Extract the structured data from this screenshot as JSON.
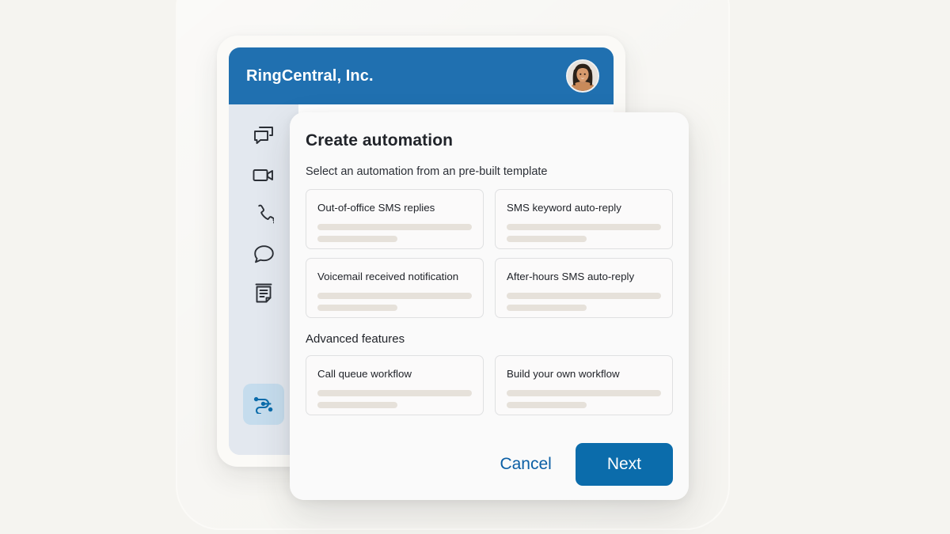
{
  "app": {
    "title": "RingCentral, Inc.",
    "header_color": "#2070b0",
    "avatar_name": "user-avatar",
    "sidebar": {
      "items": [
        {
          "icon": "messages-icon",
          "label": "Message",
          "active": false
        },
        {
          "icon": "video-camera-icon",
          "label": "Video",
          "active": false
        },
        {
          "icon": "phone-icon",
          "label": "Phone",
          "active": false
        },
        {
          "icon": "speech-bubble-icon",
          "label": "Text",
          "active": false
        },
        {
          "icon": "fax-document-icon",
          "label": "Fax",
          "active": false
        }
      ],
      "bottom_item": {
        "icon": "automation-workflow-icon",
        "label": "Automation",
        "active": true,
        "active_color": "#0b6cab",
        "active_bg": "#c5dced"
      }
    }
  },
  "modal": {
    "title": "Create automation",
    "subtitle": "Select an automation from an pre-built template",
    "templates": [
      {
        "title": "Out-of-office SMS replies"
      },
      {
        "title": "SMS keyword auto-reply"
      },
      {
        "title": "Voicemail received notification"
      },
      {
        "title": "After-hours SMS auto-reply"
      }
    ],
    "advanced_section_title": "Advanced features",
    "advanced": [
      {
        "title": "Call queue workflow"
      },
      {
        "title": "Build your own workflow"
      }
    ],
    "footer": {
      "cancel_label": "Cancel",
      "next_label": "Next",
      "next_color": "#0b6cab",
      "cancel_color": "#0b5fa5"
    }
  }
}
